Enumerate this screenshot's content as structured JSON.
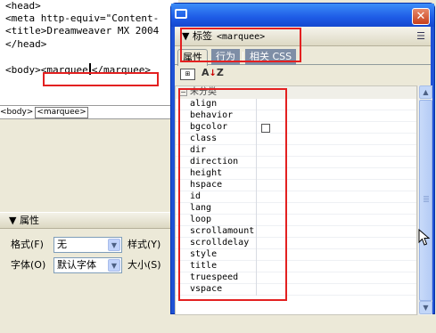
{
  "code": {
    "lines": [
      "<head>",
      "<meta http-equiv=\"Content-",
      "<title>Dreamweaver MX 2004",
      "</head>"
    ],
    "body_prefix": "<body>",
    "body_tag_open": "<marquee",
    "body_tag_close": "</marquee>"
  },
  "tag_selector": {
    "items": [
      "<body>",
      "<marquee>"
    ]
  },
  "properties": {
    "header": "属性",
    "format_label": "格式(F)",
    "format_value": "无",
    "style_label": "样式(Y)",
    "font_label": "字体(O)",
    "font_value": "默认字体",
    "size_label": "大小(S)"
  },
  "panel": {
    "header_title": "标签",
    "header_tag": "<marquee>",
    "tabs": [
      "属性",
      "行为",
      "相关 CSS"
    ],
    "category": "未分类",
    "attributes": [
      "align",
      "behavior",
      "bgcolor",
      "class",
      "dir",
      "direction",
      "height",
      "hspace",
      "id",
      "lang",
      "loop",
      "scrollamount",
      "scrolldelay",
      "style",
      "title",
      "truespeed",
      "vspace"
    ]
  },
  "colors": {
    "highlight": "#e32020",
    "titlebar": "#1f52d6"
  }
}
